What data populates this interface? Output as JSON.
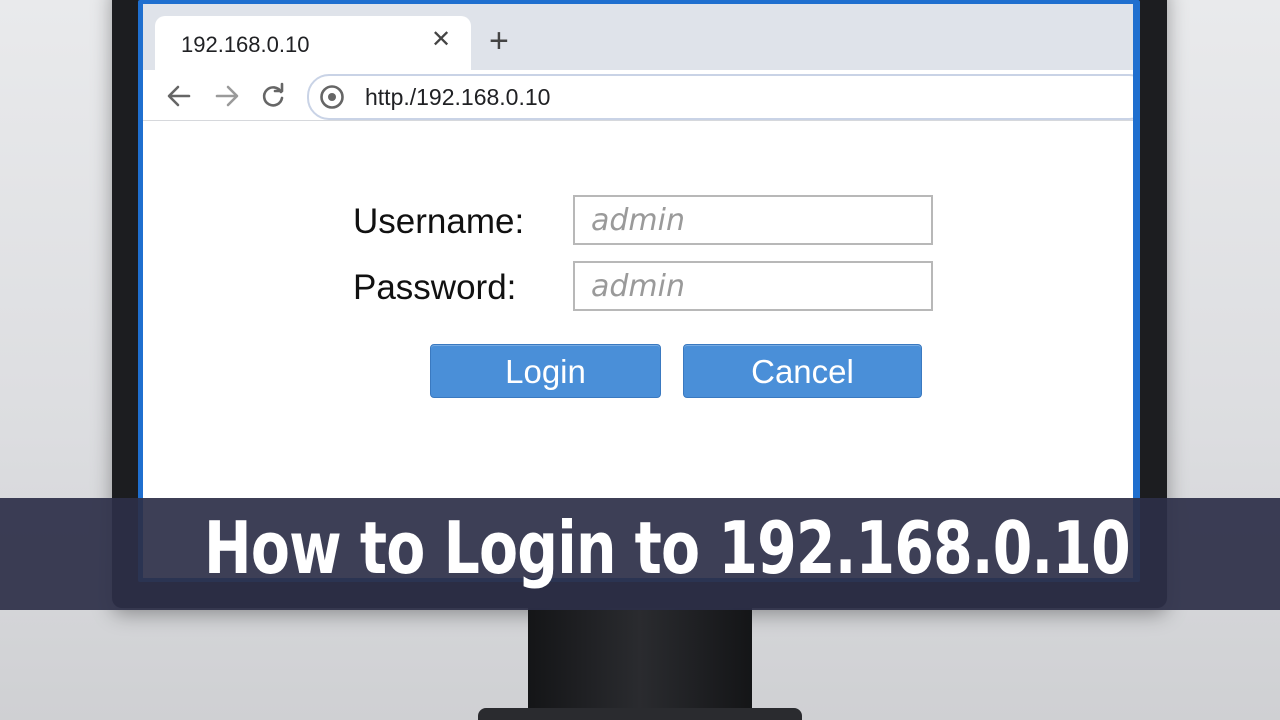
{
  "browser": {
    "tab": {
      "title": "192.168.0.10",
      "close_icon": "close-icon"
    },
    "new_tab_icon": "plus-icon",
    "toolbar": {
      "back_icon": "arrow-left-icon",
      "forward_icon": "arrow-right-icon",
      "reload_icon": "reload-icon",
      "site_icon": "site-info-icon",
      "url": "http./192.168.0.10"
    }
  },
  "login_form": {
    "username_label": "Username:",
    "username_placeholder": "admin",
    "password_label": "Password:",
    "password_placeholder": "admin",
    "login_button": "Login",
    "cancel_button": "Cancel"
  },
  "banner": {
    "title": "How to Login to 192.168.0.10"
  },
  "colors": {
    "button": "#4a8fd8",
    "screen_border": "#1f6fcf",
    "banner": "#2d2f48"
  }
}
